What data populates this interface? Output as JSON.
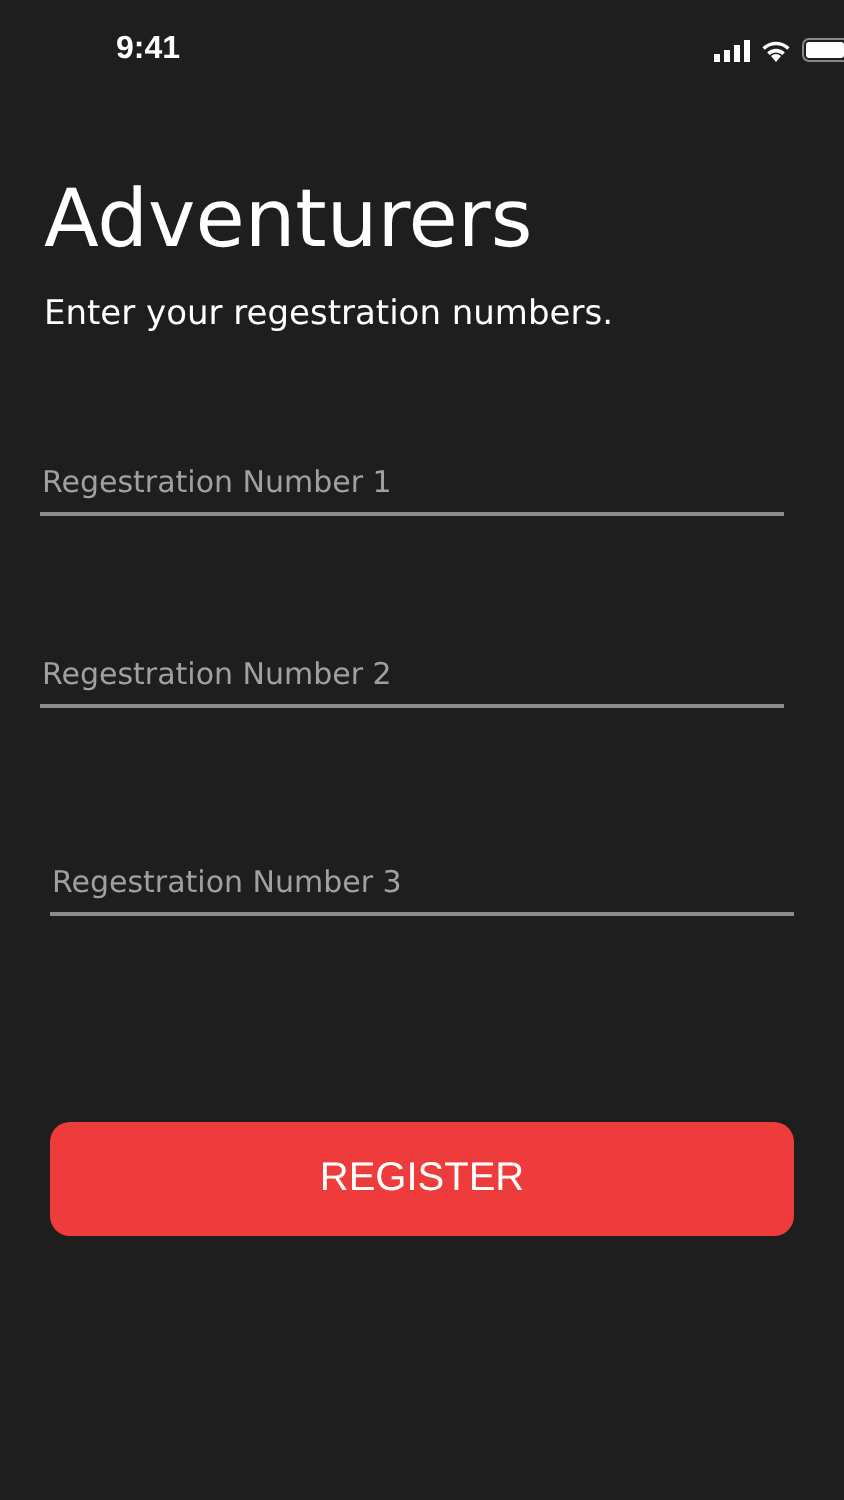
{
  "status_bar": {
    "time": "9:41"
  },
  "title": "Adventurers",
  "subtitle": "Enter your regestration numbers.",
  "fields": [
    {
      "placeholder": "Regestration Number 1"
    },
    {
      "placeholder": "Regestration Number 2"
    },
    {
      "placeholder": "Regestration Number 3"
    }
  ],
  "button": "REGISTER"
}
